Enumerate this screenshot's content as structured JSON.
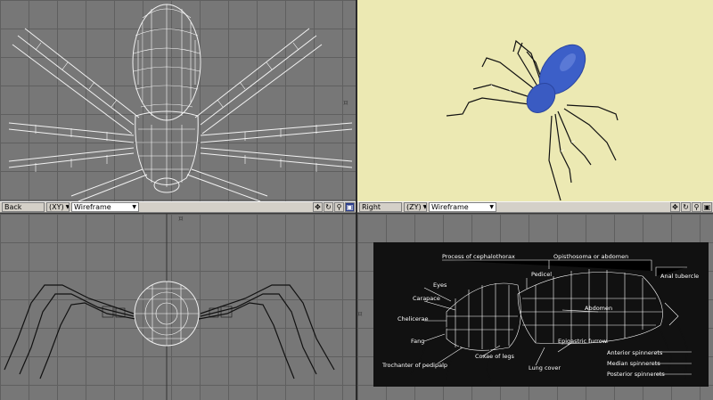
{
  "viewports": {
    "back": {
      "view_label": "Back",
      "axis_label": "(XY)",
      "mode_label": "Wireframe",
      "tools": [
        "move-icon",
        "rotate-icon",
        "zoom-icon",
        "maximize-icon"
      ]
    },
    "right": {
      "view_label": "Right",
      "axis_label": "(ZY)",
      "mode_label": "Wireframe",
      "tools": [
        "move-icon",
        "rotate-icon",
        "zoom-icon",
        "maximize-icon"
      ]
    }
  },
  "reference_labels": {
    "process": "Process of cephalothorax",
    "opisthosoma": "Opisthosoma or abdomen",
    "pedicel": "Pedicel",
    "eyes": "Eyes",
    "anal_tubercle": "Anal tubercle",
    "abdomen": "Abdomen",
    "carapace": "Carapace",
    "chelicerae": "Chelicerae",
    "fang": "Fang",
    "epigastric_furrow": "Epigastric furrow",
    "coxae": "Coxae of legs",
    "trochanter": "Trochanter of pedipalp",
    "lung_cover": "Lung cover",
    "anterior_spinnerets": "Anterior spinnerets",
    "median_spinnerets": "Median spinnerets",
    "posterior_spinnerets": "Posterior spinnerets"
  },
  "colors": {
    "grid_bg": "#777777",
    "perspective_bg": "#ece9b3",
    "spider_body": "#3c5fc8",
    "toolbar": "#d4d0c8",
    "active_button": "#2a3c8a"
  }
}
